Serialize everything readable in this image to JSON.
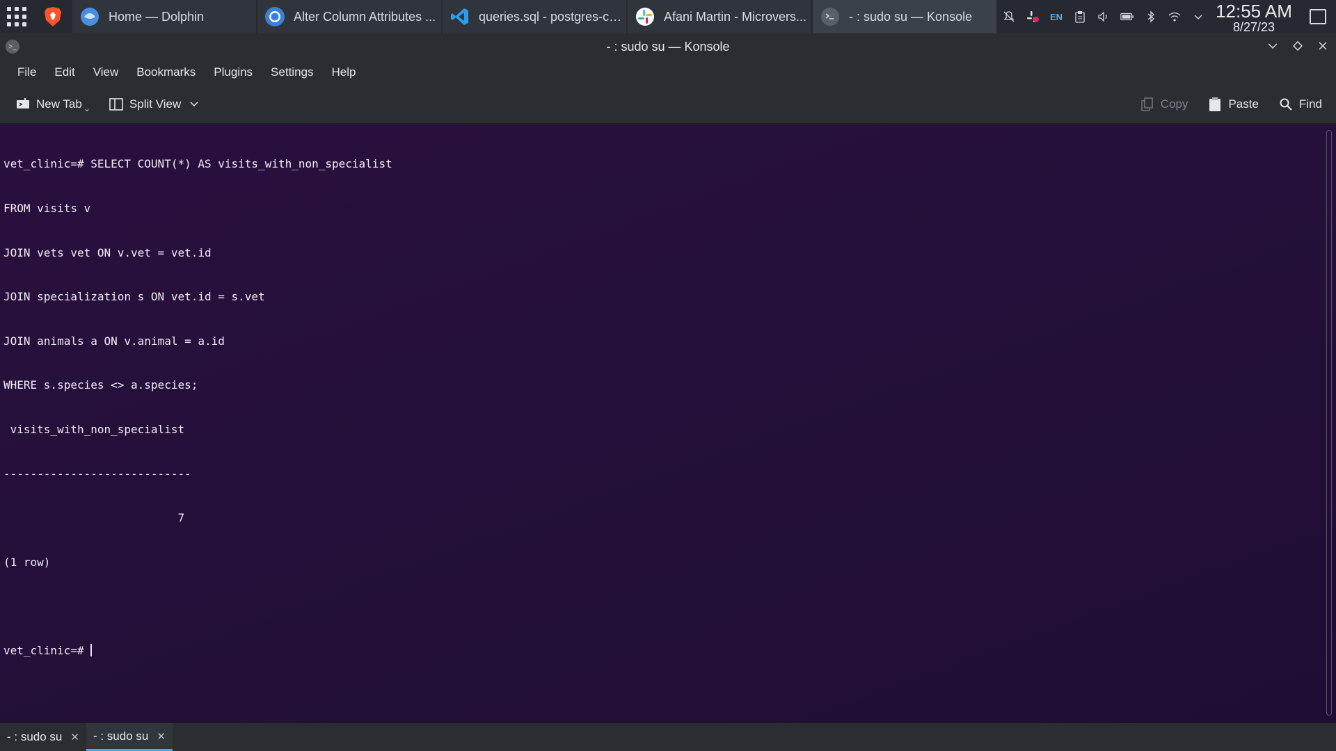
{
  "taskbar": {
    "tasks": [
      {
        "label": "Home — Dolphin",
        "icon": "dolphin-icon"
      },
      {
        "label": "Alter Column Attributes ...",
        "icon": "chrome-icon"
      },
      {
        "label": "queries.sql - postgres-co...",
        "icon": "vscode-icon"
      },
      {
        "label": "Afani Martin - Microvers...",
        "icon": "slack-icon"
      },
      {
        "label": "- : sudo su — Konsole",
        "icon": "konsole-icon"
      }
    ],
    "tray": {
      "language": "EN"
    },
    "clock": {
      "time": "12:55 AM",
      "date": "8/27/23"
    }
  },
  "window": {
    "title": "- : sudo su — Konsole"
  },
  "menubar": {
    "items": [
      "File",
      "Edit",
      "View",
      "Bookmarks",
      "Plugins",
      "Settings",
      "Help"
    ]
  },
  "toolbar": {
    "new_tab": "New Tab",
    "split_view": "Split View",
    "copy": "Copy",
    "paste": "Paste",
    "find": "Find"
  },
  "terminal": {
    "lines": [
      "vet_clinic=# SELECT COUNT(*) AS visits_with_non_specialist",
      "FROM visits v",
      "JOIN vets vet ON v.vet = vet.id",
      "JOIN specialization s ON vet.id = s.vet",
      "JOIN animals a ON v.animal = a.id",
      "WHERE s.species <> a.species;",
      " visits_with_non_specialist",
      "----------------------------",
      "                          7",
      "(1 row)",
      ""
    ],
    "prompt": "vet_clinic=# "
  },
  "tabs": [
    {
      "label": "- : sudo su",
      "active": false
    },
    {
      "label": "- : sudo su",
      "active": true
    }
  ],
  "colors": {
    "accent": "#3daee9",
    "terminal_bg": "#24103a"
  }
}
